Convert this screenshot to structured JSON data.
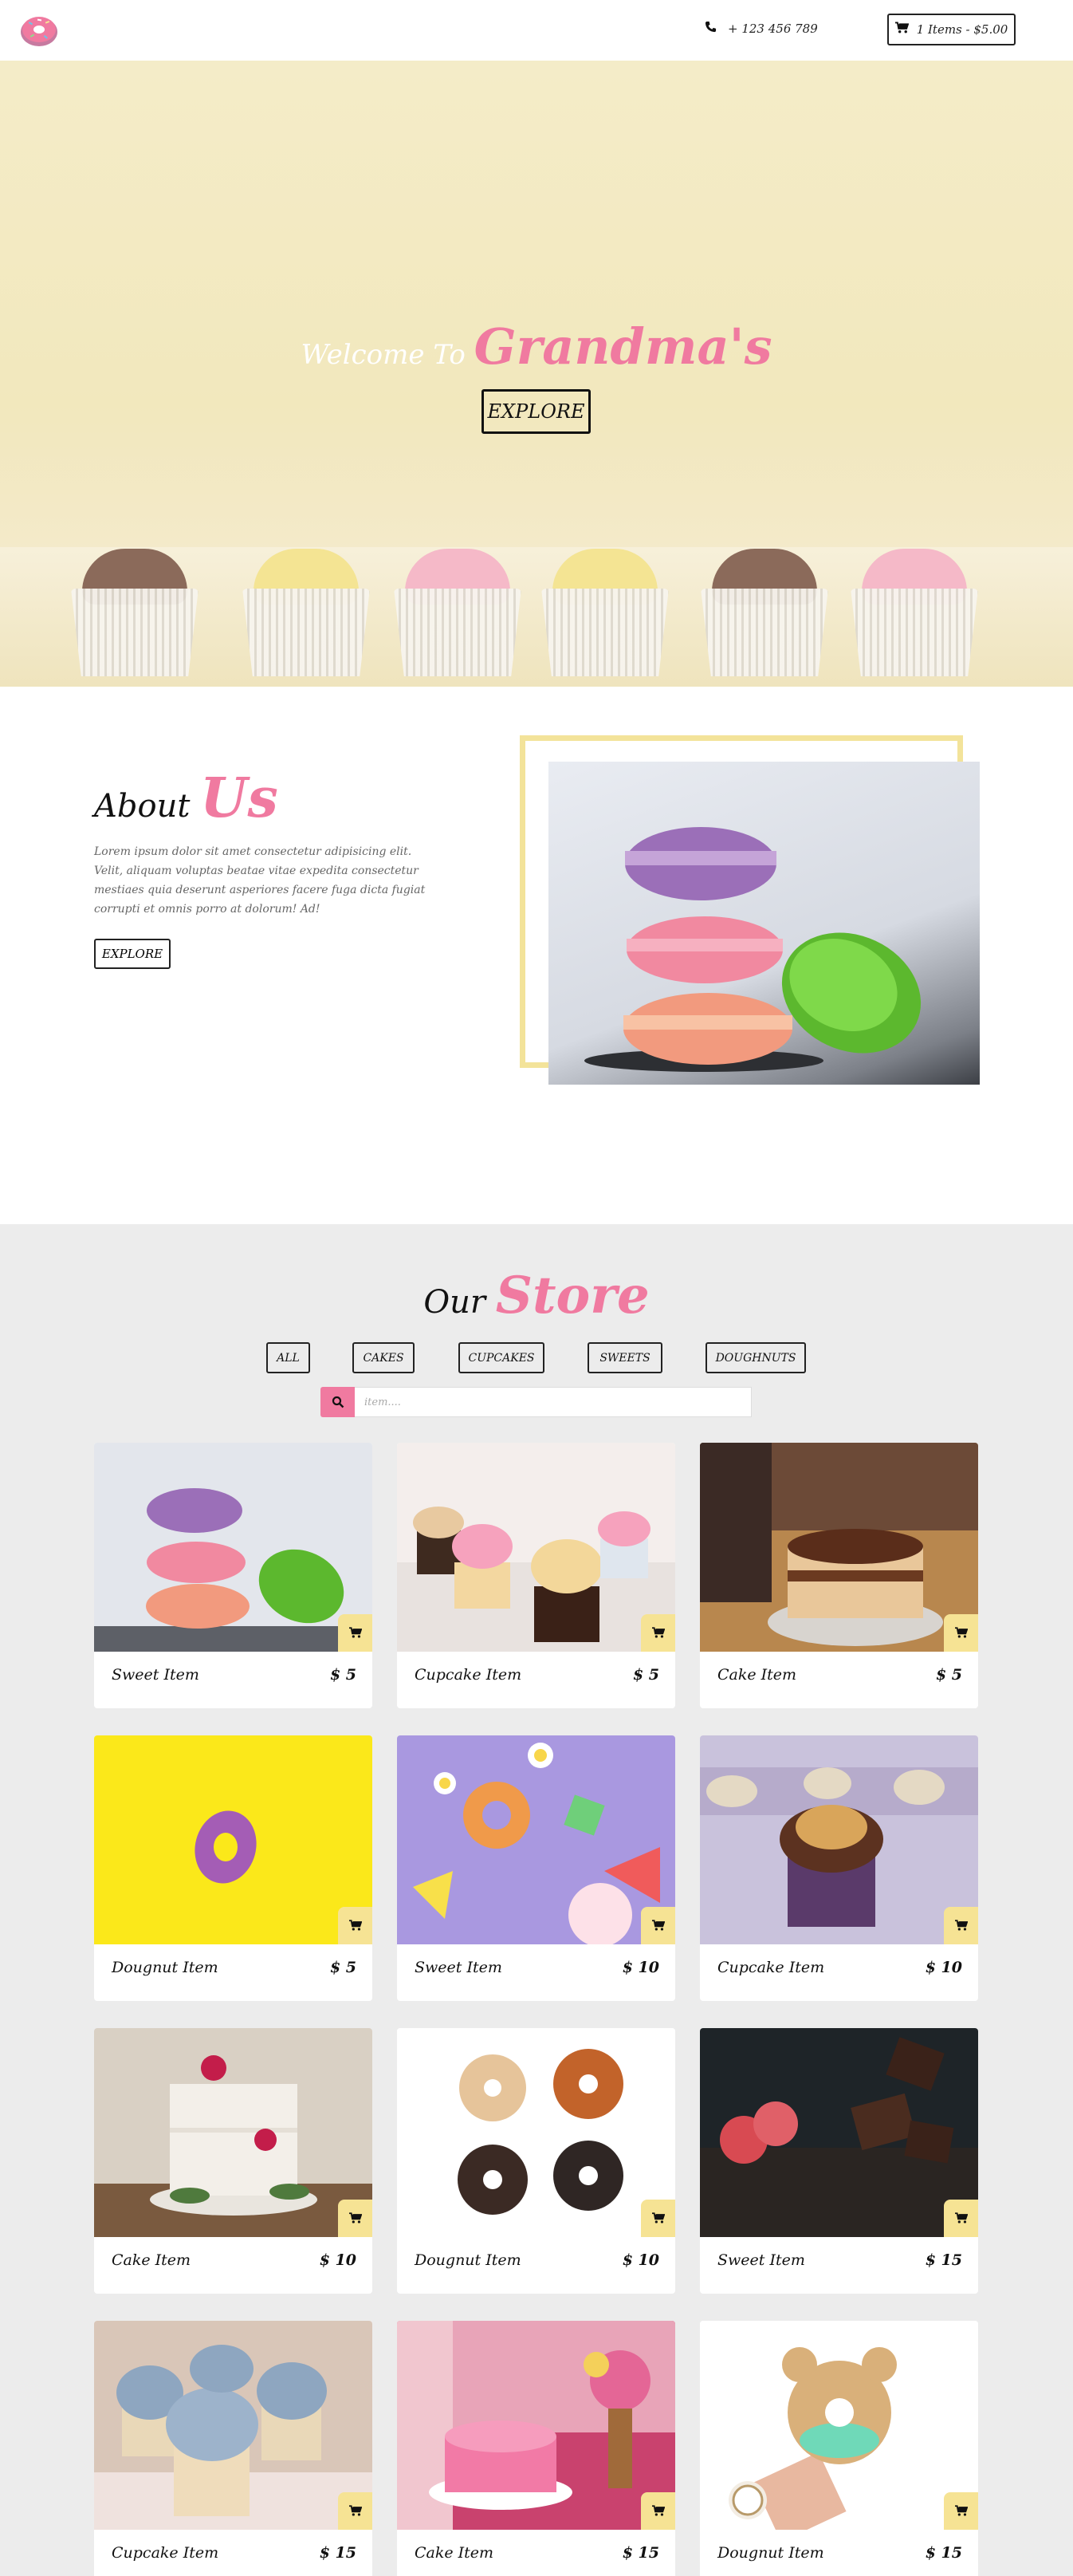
{
  "navbar": {
    "phone": "+ 123 456 789",
    "cart": "1 Items - $5.00"
  },
  "hero": {
    "welcome": "Welcome To",
    "brand": "Grandma's",
    "button": "EXPLORE",
    "macaron_colors": [
      "#8b6a5a",
      "#f4e493",
      "#f5b9c8",
      "#f4e493",
      "#8b6a5a",
      "#f5b9c8"
    ]
  },
  "about": {
    "title_a": "About",
    "title_b": "Us",
    "text": "Lorem ipsum dolor sit amet consectetur adipisicing elit. Velit, aliquam voluptas beatae vitae expedita consectetur mestiaes quia deserunt asperiores facere fuga dicta fugiat corrupti et omnis porro at dolorum! Ad!",
    "button": "EXPLORE"
  },
  "store": {
    "title_a": "Our",
    "title_b": "Store",
    "filters": [
      "ALL",
      "CAKES",
      "CUPCAKES",
      "SWEETS",
      "DOUGHNUTS"
    ],
    "search_placeholder": "item....",
    "items": [
      {
        "name": "Sweet Item",
        "price": "$ 5",
        "image": "macarons"
      },
      {
        "name": "Cupcake Item",
        "price": "$ 5",
        "image": "cupcakes"
      },
      {
        "name": "Cake Item",
        "price": "$ 5",
        "image": "layer-cake"
      },
      {
        "name": "Dougnut Item",
        "price": "$ 5",
        "image": "purple-donut"
      },
      {
        "name": "Sweet Item",
        "price": "$ 10",
        "image": "candy"
      },
      {
        "name": "Cupcake Item",
        "price": "$ 10",
        "image": "chocolate-cupcake"
      },
      {
        "name": "Cake Item",
        "price": "$ 10",
        "image": "white-cake"
      },
      {
        "name": "Dougnut Item",
        "price": "$ 10",
        "image": "donuts"
      },
      {
        "name": "Sweet Item",
        "price": "$ 15",
        "image": "chocolate"
      },
      {
        "name": "Cupcake Item",
        "price": "$ 15",
        "image": "blue-cupcakes"
      },
      {
        "name": "Cake Item",
        "price": "$ 15",
        "image": "pink-cake"
      },
      {
        "name": "Dougnut Item",
        "price": "$ 15",
        "image": "bear-donut"
      }
    ]
  },
  "colors": {
    "accent_pink": "#f07aa0",
    "accent_yellow": "#f6e394",
    "store_bg": "#ececec"
  }
}
